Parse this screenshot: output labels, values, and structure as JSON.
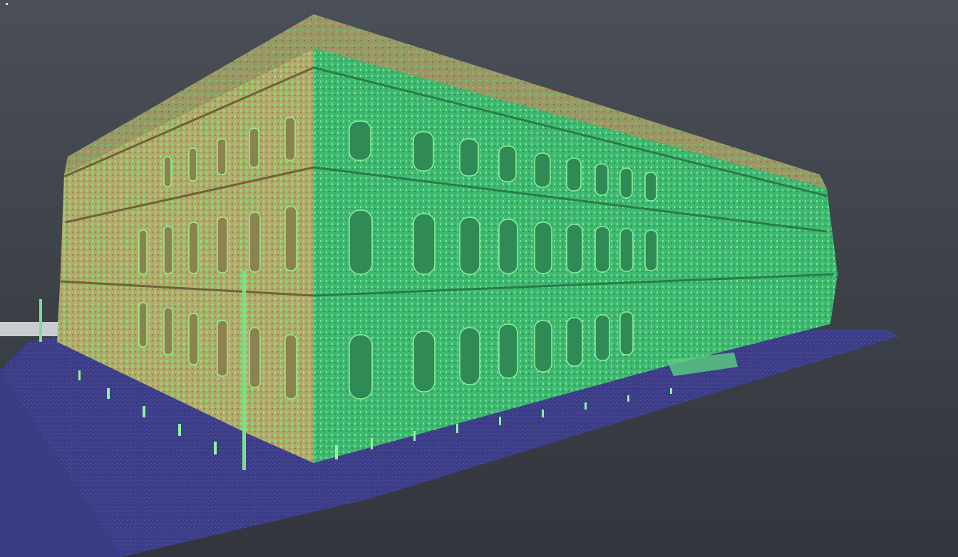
{
  "viewport": {
    "background_top": "#4a4f58",
    "background_bottom": "#33363c"
  },
  "point_cloud": {
    "subject": "building",
    "colors": {
      "ground": "#3e3f8a",
      "ground_light": "#5a5fb0",
      "facade_front": "#43c47a",
      "facade_front_light": "#7ef07a",
      "facade_side": "#b8ae6e",
      "facade_side_dark": "#8c8450",
      "roof": "#9e9a6a",
      "accent": "#a0f060"
    }
  }
}
